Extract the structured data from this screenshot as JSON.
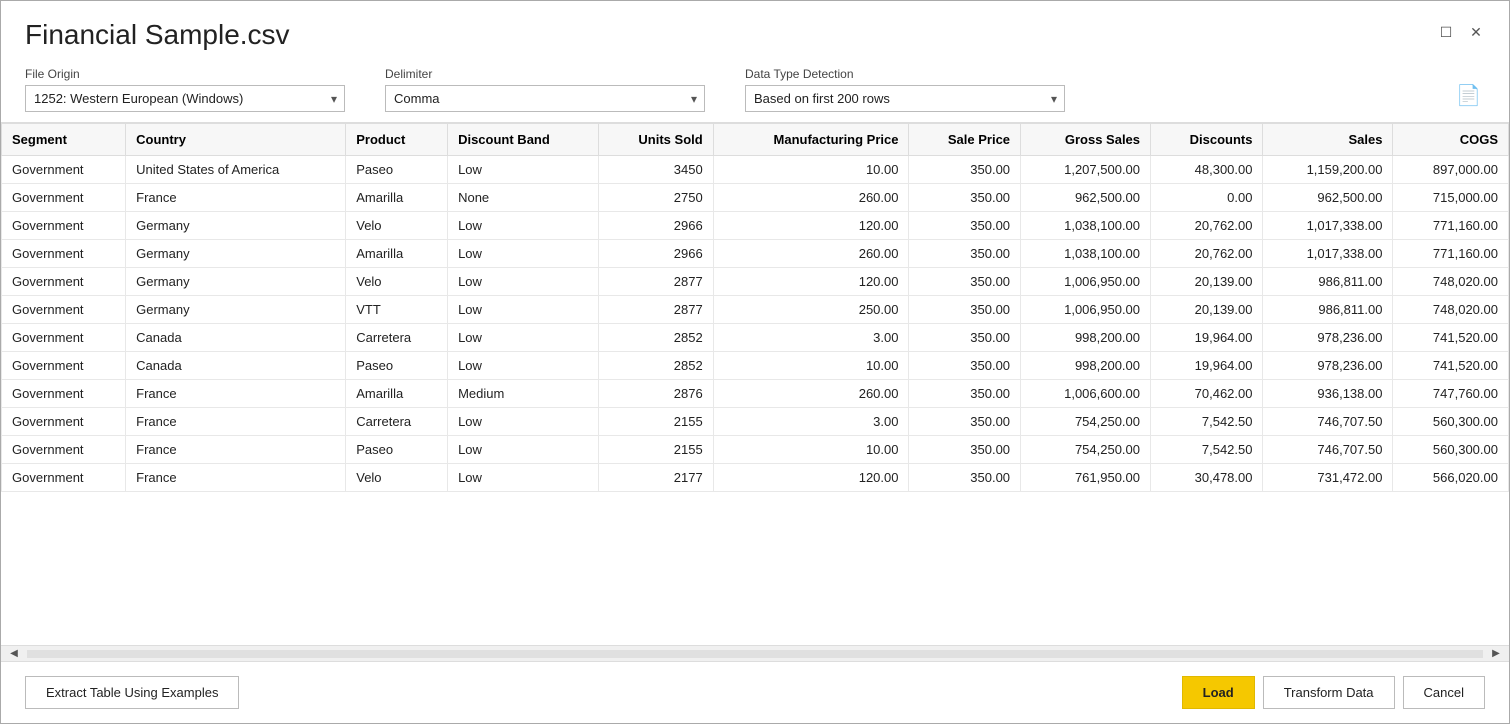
{
  "dialog": {
    "title": "Financial Sample.csv",
    "close_label": "✕",
    "maximize_label": "☐"
  },
  "controls": {
    "file_origin_label": "File Origin",
    "file_origin_value": "1252: Western European (Windows)",
    "delimiter_label": "Delimiter",
    "delimiter_value": "Comma",
    "data_type_label": "Data Type Detection",
    "data_type_value": "Based on first 200 rows",
    "file_icon": "🗋"
  },
  "table": {
    "columns": [
      {
        "key": "segment",
        "label": "Segment",
        "align": "left"
      },
      {
        "key": "country",
        "label": "Country",
        "align": "left"
      },
      {
        "key": "product",
        "label": "Product",
        "align": "left"
      },
      {
        "key": "discount_band",
        "label": "Discount Band",
        "align": "left"
      },
      {
        "key": "units_sold",
        "label": "Units Sold",
        "align": "right"
      },
      {
        "key": "manufacturing_price",
        "label": "Manufacturing Price",
        "align": "right"
      },
      {
        "key": "sale_price",
        "label": "Sale Price",
        "align": "right"
      },
      {
        "key": "gross_sales",
        "label": "Gross Sales",
        "align": "right"
      },
      {
        "key": "discounts",
        "label": "Discounts",
        "align": "right"
      },
      {
        "key": "sales",
        "label": "Sales",
        "align": "right"
      },
      {
        "key": "cogs",
        "label": "COGS",
        "align": "right"
      }
    ],
    "rows": [
      [
        "Government",
        "United States of America",
        "Paseo",
        "Low",
        "3450",
        "10.00",
        "350.00",
        "1,207,500.00",
        "48,300.00",
        "1,159,200.00",
        "897,000.00"
      ],
      [
        "Government",
        "France",
        "Amarilla",
        "None",
        "2750",
        "260.00",
        "350.00",
        "962,500.00",
        "0.00",
        "962,500.00",
        "715,000.00"
      ],
      [
        "Government",
        "Germany",
        "Velo",
        "Low",
        "2966",
        "120.00",
        "350.00",
        "1,038,100.00",
        "20,762.00",
        "1,017,338.00",
        "771,160.00"
      ],
      [
        "Government",
        "Germany",
        "Amarilla",
        "Low",
        "2966",
        "260.00",
        "350.00",
        "1,038,100.00",
        "20,762.00",
        "1,017,338.00",
        "771,160.00"
      ],
      [
        "Government",
        "Germany",
        "Velo",
        "Low",
        "2877",
        "120.00",
        "350.00",
        "1,006,950.00",
        "20,139.00",
        "986,811.00",
        "748,020.00"
      ],
      [
        "Government",
        "Germany",
        "VTT",
        "Low",
        "2877",
        "250.00",
        "350.00",
        "1,006,950.00",
        "20,139.00",
        "986,811.00",
        "748,020.00"
      ],
      [
        "Government",
        "Canada",
        "Carretera",
        "Low",
        "2852",
        "3.00",
        "350.00",
        "998,200.00",
        "19,964.00",
        "978,236.00",
        "741,520.00"
      ],
      [
        "Government",
        "Canada",
        "Paseo",
        "Low",
        "2852",
        "10.00",
        "350.00",
        "998,200.00",
        "19,964.00",
        "978,236.00",
        "741,520.00"
      ],
      [
        "Government",
        "France",
        "Amarilla",
        "Medium",
        "2876",
        "260.00",
        "350.00",
        "1,006,600.00",
        "70,462.00",
        "936,138.00",
        "747,760.00"
      ],
      [
        "Government",
        "France",
        "Carretera",
        "Low",
        "2155",
        "3.00",
        "350.00",
        "754,250.00",
        "7,542.50",
        "746,707.50",
        "560,300.00"
      ],
      [
        "Government",
        "France",
        "Paseo",
        "Low",
        "2155",
        "10.00",
        "350.00",
        "754,250.00",
        "7,542.50",
        "746,707.50",
        "560,300.00"
      ],
      [
        "Government",
        "France",
        "Velo",
        "Low",
        "2177",
        "120.00",
        "350.00",
        "761,950.00",
        "30,478.00",
        "731,472.00",
        "566,020.00"
      ]
    ]
  },
  "footer": {
    "extract_label": "Extract Table Using Examples",
    "load_label": "Load",
    "transform_label": "Transform Data",
    "cancel_label": "Cancel"
  }
}
